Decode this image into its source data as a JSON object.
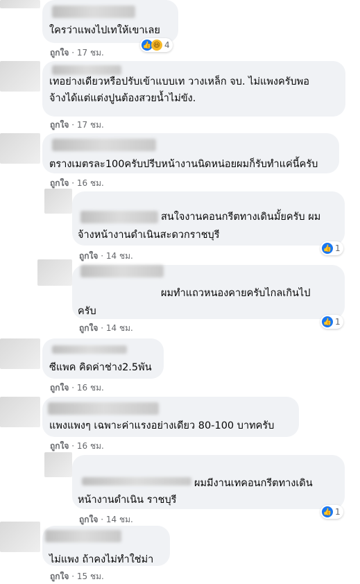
{
  "comments": [
    {
      "text1": "ใครว่าแพงไปเทให้เขาเลย",
      "text2": "",
      "like": "ถูกใจ",
      "time": "17 ชม.",
      "reaction_count": "4"
    },
    {
      "text1": "เทอย่างเดียวหรือปรับเข้าแบบเท วางเหล็ก จบ. ไม่แพงครับพอ",
      "text2": "จ้างได้แต่แต่งปูนต้องสวยน้ำไม่ขัง.",
      "like": "ถูกใจ",
      "time": "17 ชม."
    },
    {
      "text1": "ตรางเมตรละ100ครับปรีบหน้างานนิดหน่อยผมก็รับทำแค่นี้ครับ",
      "text2": "",
      "like": "ถูกใจ",
      "time": "16 ชม."
    },
    {
      "text1": "สนใจงานคอนกรีตทางเดินมั้ยครับ ผม",
      "text2": "จ้างหน้างานดำเนินสะดวกราชบุรี",
      "like": "ถูกใจ",
      "time": "14 ชม.",
      "reaction_count": "1"
    },
    {
      "text1": "ผมทำแถวหนองคายครับไกลเกินไป",
      "text2": "ครับ",
      "like": "ถูกใจ",
      "time": "14 ชม.",
      "reaction_count": "1"
    },
    {
      "text1": "ซีแพค คิดค่าช่าง2.5พัน",
      "text2": "",
      "like": "ถูกใจ",
      "time": "16 ชม."
    },
    {
      "text1": "แพงแพงๆ เฉพาะค่าแรงอย่างเดียว 80-100 บาทครับ",
      "text2": "",
      "like": "ถูกใจ",
      "time": "16 ชม."
    },
    {
      "text1": "ผมมีงานเทคอนกรีตทางเดิน",
      "text2": "หน้างานดำเนิน ราชบุรี",
      "like": "ถูกใจ",
      "time": "14 ชม.",
      "reaction_count": "1"
    },
    {
      "text1": "ไม่แพง ถ้าคงไม่ทำใช่ม่า",
      "text2": "",
      "like": "ถูกใจ",
      "time": "15 ชม."
    }
  ],
  "separator": " · ",
  "icons": {
    "like": "like-icon",
    "haha": "haha-icon"
  },
  "colors": {
    "bubble": "#f0f2f5",
    "meta": "#65676b",
    "like_blue": "#1877f2"
  }
}
